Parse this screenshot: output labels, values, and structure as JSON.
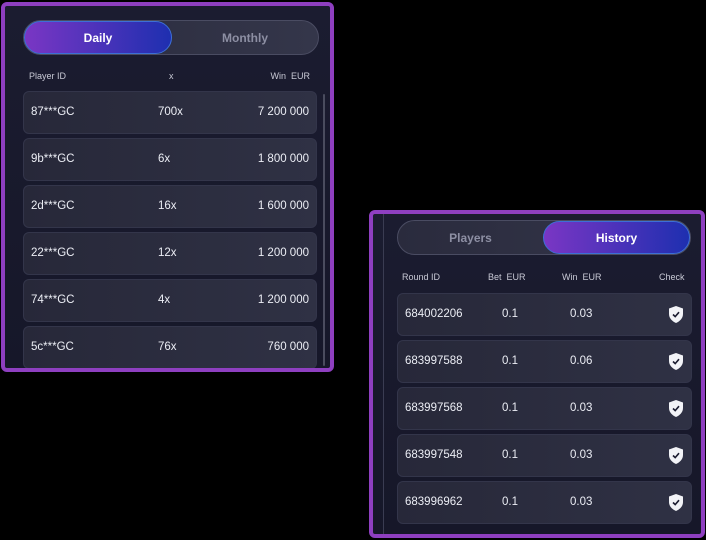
{
  "leaderboard": {
    "tabs": [
      {
        "label": "Daily",
        "active": true
      },
      {
        "label": "Monthly",
        "active": false
      }
    ],
    "headers": {
      "player": "Player ID",
      "x": "x",
      "win": "Win  EUR"
    },
    "rows": [
      {
        "player": "87***GC",
        "x": "700x",
        "win": "7 200 000"
      },
      {
        "player": "9b***GC",
        "x": "6x",
        "win": "1 800 000"
      },
      {
        "player": "2d***GC",
        "x": "16x",
        "win": "1 600 000"
      },
      {
        "player": "22***GC",
        "x": "12x",
        "win": "1 200 000"
      },
      {
        "player": "74***GC",
        "x": "4x",
        "win": "1 200 000"
      },
      {
        "player": "5c***GC",
        "x": "76x",
        "win": "760 000"
      }
    ]
  },
  "history": {
    "tabs": [
      {
        "label": "Players",
        "active": false
      },
      {
        "label": "History",
        "active": true
      }
    ],
    "headers": {
      "round": "Round ID",
      "bet": "Bet  EUR",
      "win": "Win  EUR",
      "check": "Check"
    },
    "rows": [
      {
        "round": "684002206",
        "bet": "0.1",
        "win": "0.03",
        "check_icon": "shield-check-icon"
      },
      {
        "round": "683997588",
        "bet": "0.1",
        "win": "0.06",
        "check_icon": "shield-check-icon"
      },
      {
        "round": "683997568",
        "bet": "0.1",
        "win": "0.03",
        "check_icon": "shield-check-icon"
      },
      {
        "round": "683997548",
        "bet": "0.1",
        "win": "0.03",
        "check_icon": "shield-check-icon"
      },
      {
        "round": "683996962",
        "bet": "0.1",
        "win": "0.03",
        "check_icon": "shield-check-icon"
      }
    ]
  },
  "colors": {
    "border": "#8e3fc0",
    "active_tab_start": "#7a36c4",
    "active_tab_end": "#1e2fb0"
  }
}
